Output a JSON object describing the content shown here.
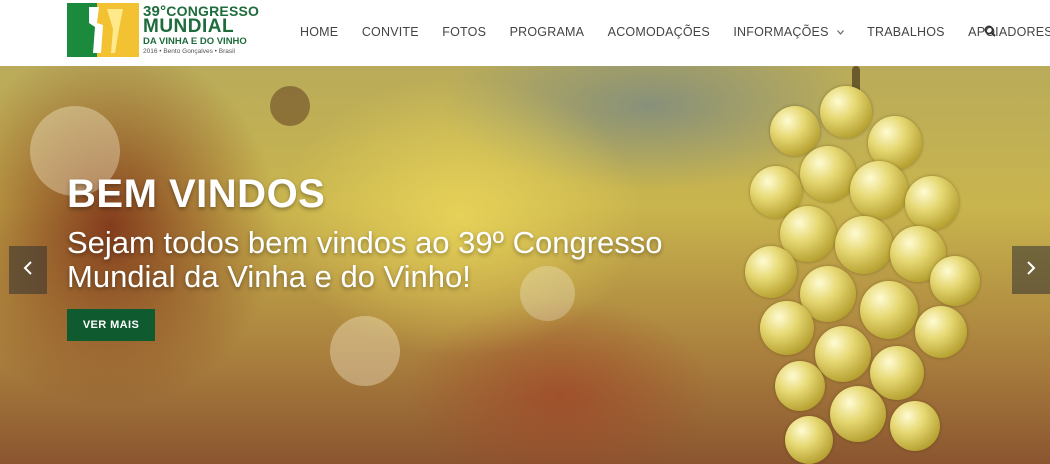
{
  "logo": {
    "line1_num": "39°",
    "line1_text": "CONGRESSO",
    "line2": "MUNDIAL",
    "line3": "DA VINHA E DO VINHO",
    "line4": "2016 • Bento Gonçalves • Brasil"
  },
  "nav": {
    "items": [
      {
        "label": "HOME"
      },
      {
        "label": "CONVITE"
      },
      {
        "label": "FOTOS"
      },
      {
        "label": "PROGRAMA"
      },
      {
        "label": "ACOMODAÇÕES"
      },
      {
        "label": "INFORMAÇÕES"
      },
      {
        "label": "TRABALHOS"
      },
      {
        "label": "APOIADORES"
      }
    ],
    "icons": [
      "chevron-down-icon",
      "search-icon"
    ]
  },
  "hero": {
    "title": "BEM VINDOS",
    "subtitle": "Sejam todos bem vindos ao 39º Congresso Mundial da Vinha e do Vinho!",
    "button": "VER MAIS"
  },
  "colors": {
    "brand_green": "#0f5a2e",
    "logo_green": "#1e6b3c",
    "logo_yellow": "#f2c230"
  }
}
